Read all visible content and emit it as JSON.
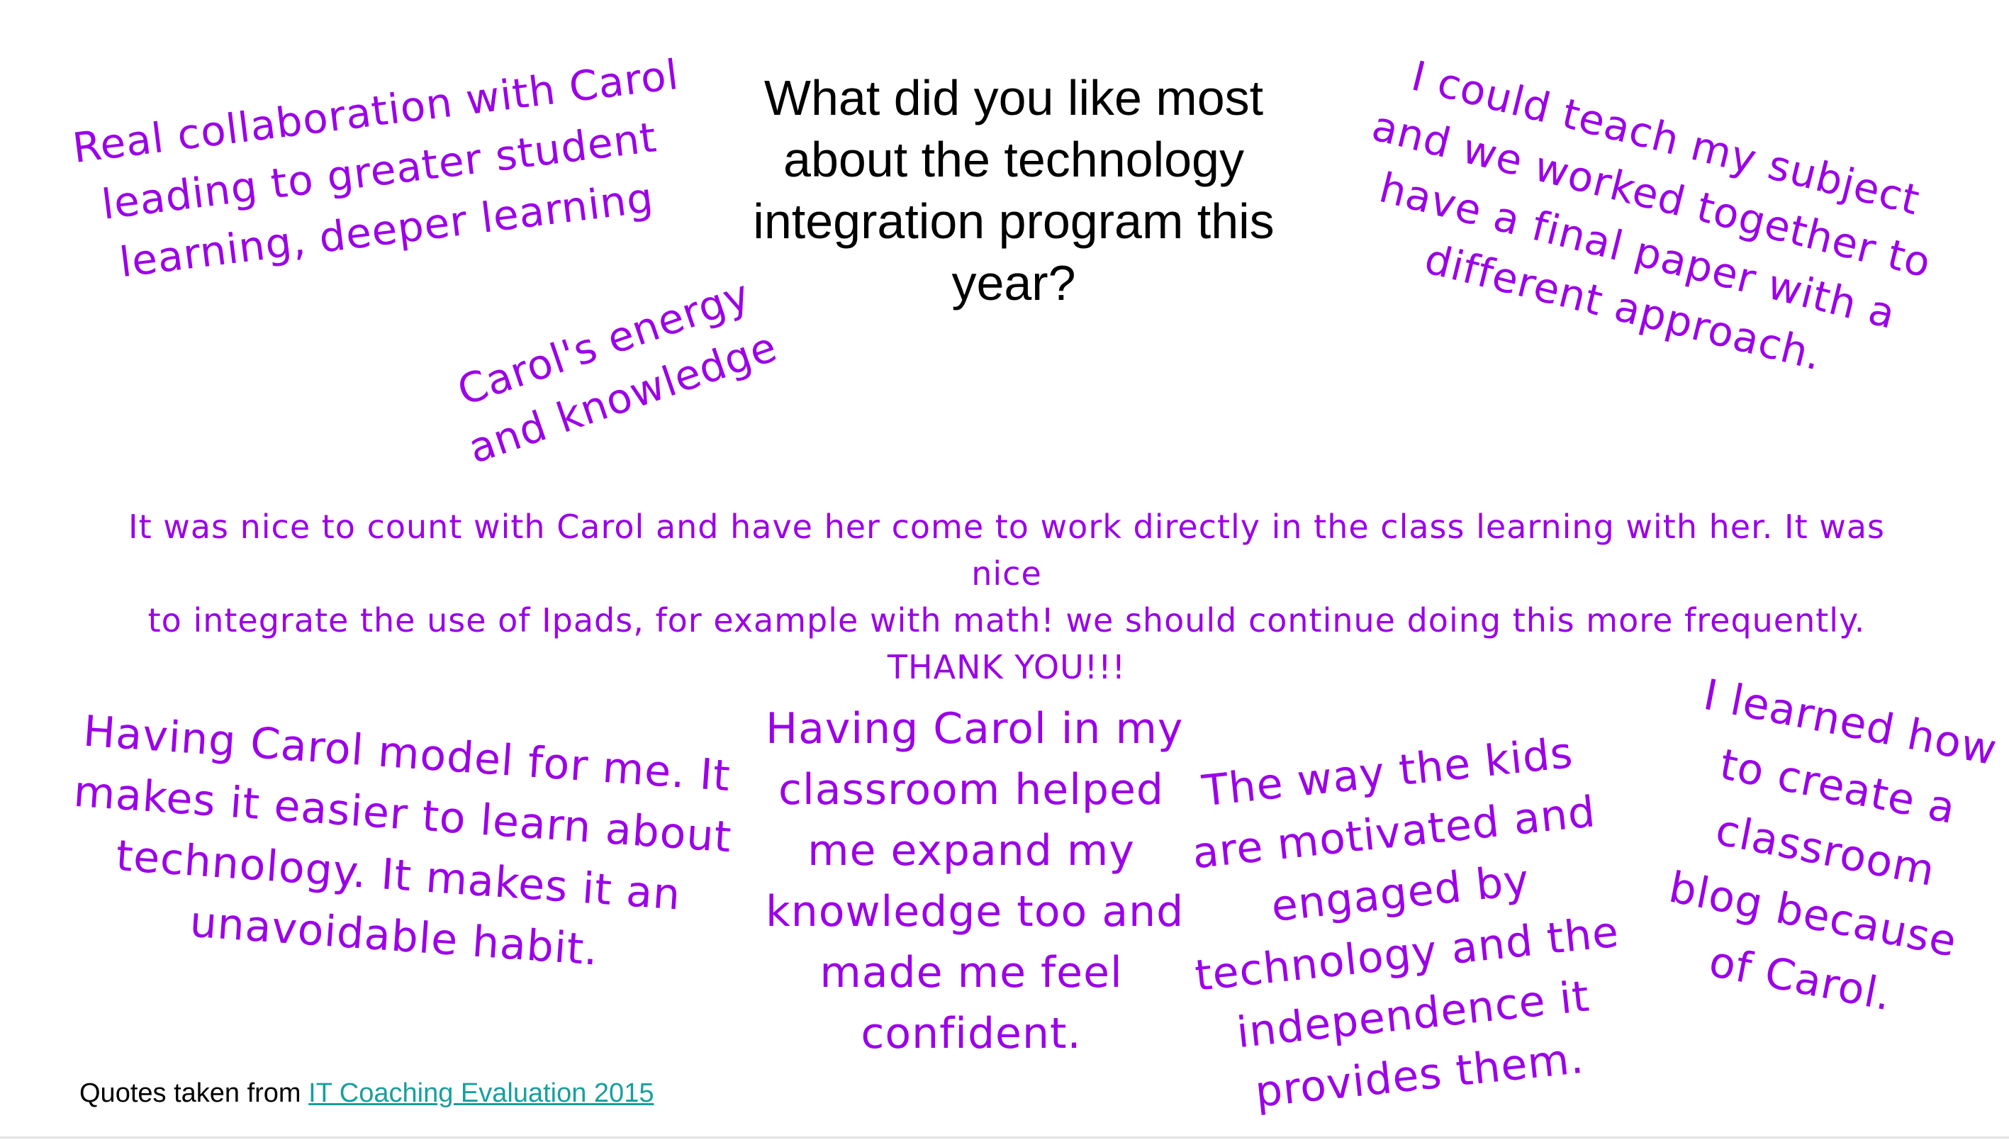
{
  "slide": {
    "title_lines": [
      "What did you like most",
      "about the technology",
      "integration program this",
      "year?"
    ],
    "quotes": [
      {
        "lines": [
          "Real collaboration with Carol",
          "leading to greater student",
          "learning, deeper learning"
        ]
      },
      {
        "lines": [
          "Carol's energy",
          "and knowledge"
        ]
      },
      {
        "lines": [
          "I could teach my subject",
          "and we worked together to",
          "have a final paper with a",
          "different approach."
        ]
      },
      {
        "lines": [
          "It was nice to count with Carol and have her come to work directly in the class learning with her.  It was nice",
          "to integrate the use of Ipads, for example with math!  we should continue doing this more frequently.",
          "THANK YOU!!!"
        ]
      },
      {
        "lines": [
          "Having Carol model for me. It",
          "makes it easier to learn about",
          "technology. It makes it an",
          "unavoidable habit."
        ]
      },
      {
        "lines": [
          "Having Carol in my",
          "classroom helped",
          "me expand my",
          "knowledge too and",
          "made me feel",
          "confident."
        ]
      },
      {
        "lines": [
          "The way the kids",
          "are motivated and",
          "engaged by",
          "technology and the",
          "independence it",
          "provides them."
        ]
      },
      {
        "lines": [
          "I learned how",
          "to create a",
          "classroom",
          "blog because",
          "of Carol."
        ]
      }
    ],
    "source": {
      "prefix": "Quotes taken from ",
      "link_text": "IT Coaching Evaluation 2015"
    },
    "colors": {
      "quote_text": "#9b00e8",
      "link": "#1a9e9e",
      "title_text": "#000000",
      "background": "#ffffff"
    }
  }
}
